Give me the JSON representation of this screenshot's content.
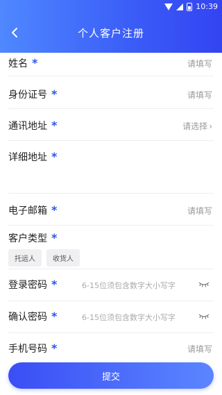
{
  "statusbar": {
    "time": "10:39"
  },
  "header": {
    "title": "个人客户注册"
  },
  "form": {
    "star": "*",
    "name": {
      "label": "姓名",
      "placeholder": "请填写"
    },
    "id_number": {
      "label": "身份证号",
      "placeholder": "请填写"
    },
    "address": {
      "label": "通讯地址",
      "placeholder": "请选择",
      "chevron": "›"
    },
    "detail_address": {
      "label": "详细地址"
    },
    "email": {
      "label": "电子邮箱",
      "placeholder": "请填写"
    },
    "customer_type": {
      "label": "客户类型",
      "options": [
        "托运人",
        "收货人"
      ]
    },
    "login_password": {
      "label": "登录密码",
      "placeholder": "6-15位须包含数字大小写字"
    },
    "confirm_password": {
      "label": "确认密码",
      "placeholder": "6-15位须包含数字大小写字"
    },
    "phone": {
      "label": "手机号码",
      "placeholder": "请填写"
    }
  },
  "submit": {
    "label": "提交"
  },
  "colors": {
    "accent": "#3a5cf7",
    "star": "#2d55e8"
  }
}
